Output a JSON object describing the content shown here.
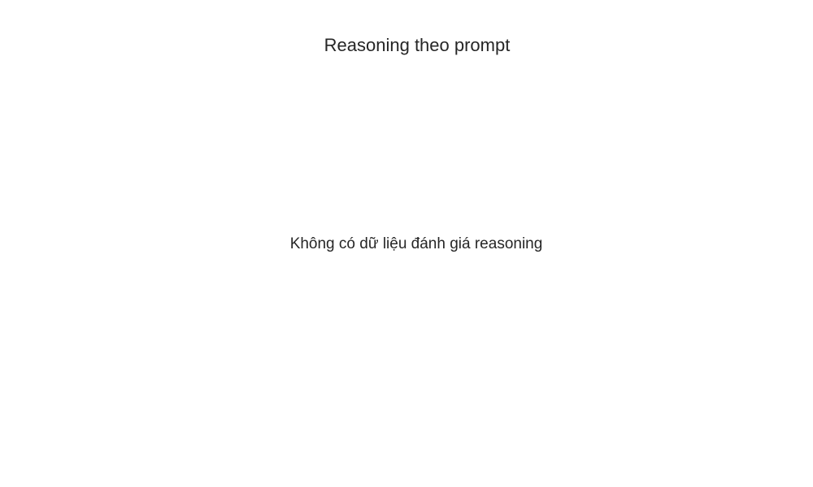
{
  "chart_data": {
    "type": "bar",
    "title": "Reasoning theo prompt",
    "message": "Không có dữ liệu đánh giá reasoning",
    "categories": [],
    "series": [],
    "xlabel": "",
    "ylabel": "",
    "grid": false,
    "legend": "none"
  }
}
